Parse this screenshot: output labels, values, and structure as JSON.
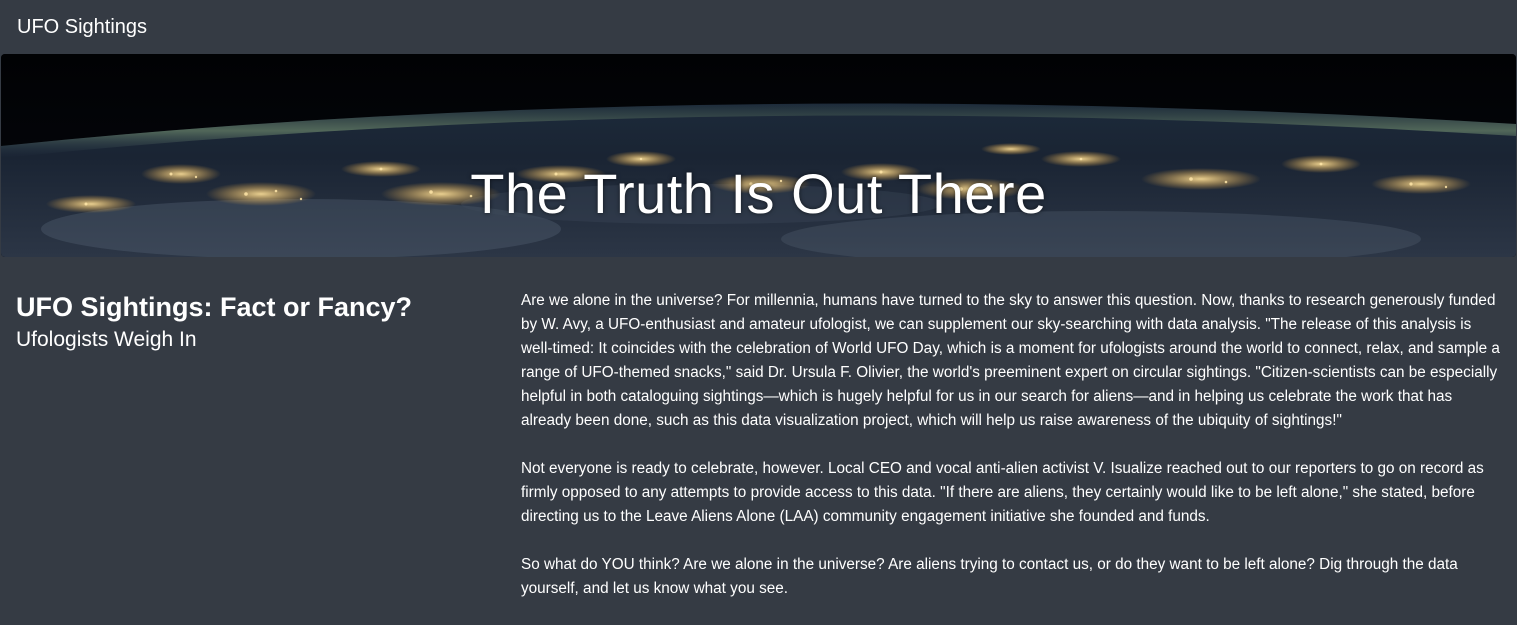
{
  "navbar": {
    "brand": "UFO Sightings"
  },
  "hero": {
    "title": "The Truth Is Out There",
    "background": "earth-at-night-from-orbit-image"
  },
  "sidebar": {
    "heading": "UFO Sightings: Fact or Fancy?",
    "subheading": "Ufologists Weigh In"
  },
  "article": {
    "paragraphs": [
      "Are we alone in the universe? For millennia, humans have turned to the sky to answer this question. Now, thanks to research generously funded by W. Avy, a UFO-enthusiast and amateur ufologist, we can supplement our sky-searching with data analysis. \"The release of this analysis is well-timed: It coincides with the celebration of World UFO Day, which is a moment for ufologists around the world to connect, relax, and sample a range of UFO-themed snacks,\" said Dr. Ursula F. Olivier, the world's preeminent expert on circular sightings. \"Citizen-scientists can be especially helpful in both cataloguing sightings—which is hugely helpful for us in our search for aliens—and in helping us celebrate the work that has already been done, such as this data visualization project, which will help us raise awareness of the ubiquity of sightings!\"",
      "Not everyone is ready to celebrate, however. Local CEO and vocal anti-alien activist V. Isualize reached out to our reporters to go on record as firmly opposed to any attempts to provide access to this data. \"If there are aliens, they certainly would like to be left alone,\" she stated, before directing us to the Leave Aliens Alone (LAA) community engagement initiative she founded and funds.",
      "So what do YOU think? Are we alone in the universe? Are aliens trying to contact us, or do they want to be left alone? Dig through the data yourself, and let us know what you see."
    ]
  },
  "colors": {
    "page_background": "#353b44",
    "text": "#ffffff",
    "city_lights": "#ffd27a"
  }
}
